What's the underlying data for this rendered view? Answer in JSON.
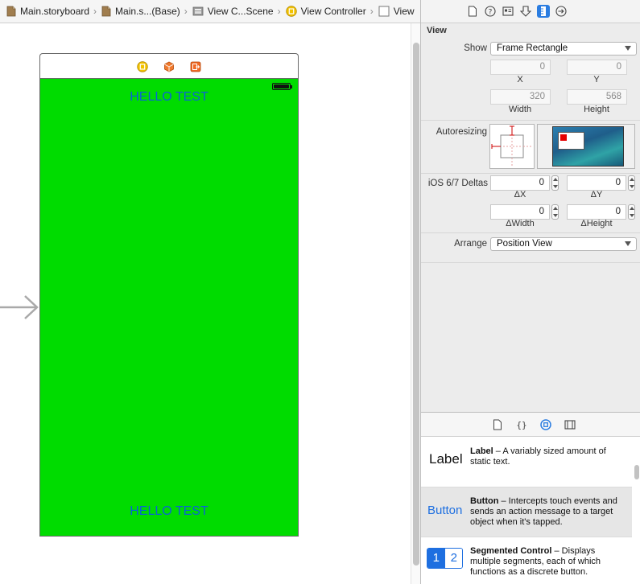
{
  "jumpbar": {
    "crumbs": [
      {
        "label": "Main.storyboard",
        "icon": "storyboard-file-icon"
      },
      {
        "label": "Main.s...(Base)",
        "icon": "storyboard-file-icon"
      },
      {
        "label": "View C...Scene",
        "icon": "scene-icon"
      },
      {
        "label": "View Controller",
        "icon": "view-controller-icon"
      },
      {
        "label": "View",
        "icon": "view-icon"
      }
    ]
  },
  "canvas": {
    "dock_icons": [
      "view-controller-icon",
      "first-responder-icon",
      "exit-icon"
    ],
    "view": {
      "background": "#00dc00",
      "top_label": "HELLO TEST",
      "bottom_label": "HELLO TEST",
      "label_color": "#0a63d6"
    }
  },
  "inspector": {
    "tabs": [
      "file-inspector-icon",
      "quick-help-icon",
      "identity-inspector-icon",
      "attributes-inspector-icon",
      "size-inspector-icon",
      "connections-inspector-icon"
    ],
    "active_tab": "size-inspector-icon",
    "section_title": "View",
    "show": {
      "label": "Show",
      "value": "Frame Rectangle"
    },
    "frame": {
      "x": "0",
      "y": "0",
      "width": "320",
      "height": "568",
      "x_label": "X",
      "y_label": "Y",
      "width_label": "Width",
      "height_label": "Height"
    },
    "autoresizing_label": "Autoresizing",
    "deltas": {
      "label": "iOS 6/7 Deltas",
      "dx": "0",
      "dy": "0",
      "dwidth": "0",
      "dheight": "0",
      "dx_label": "ΔX",
      "dy_label": "ΔY",
      "dwidth_label": "ΔWidth",
      "dheight_label": "ΔHeight"
    },
    "arrange": {
      "label": "Arrange",
      "value": "Position View"
    }
  },
  "library": {
    "tabs": [
      "file-template-icon",
      "code-snippet-icon",
      "object-library-icon",
      "media-library-icon"
    ],
    "active_tab": "object-library-icon",
    "items": [
      {
        "icon_text": "Label",
        "title": "Label",
        "desc": " – A variably sized amount of static text."
      },
      {
        "icon_text": "Button",
        "title": "Button",
        "desc": " – Intercepts touch events and sends an action message to a target object when it's tapped."
      },
      {
        "seg1": "1",
        "seg2": "2",
        "title": "Segmented Control",
        "desc": " – Displays multiple segments, each of which functions as a discrete button."
      }
    ]
  }
}
